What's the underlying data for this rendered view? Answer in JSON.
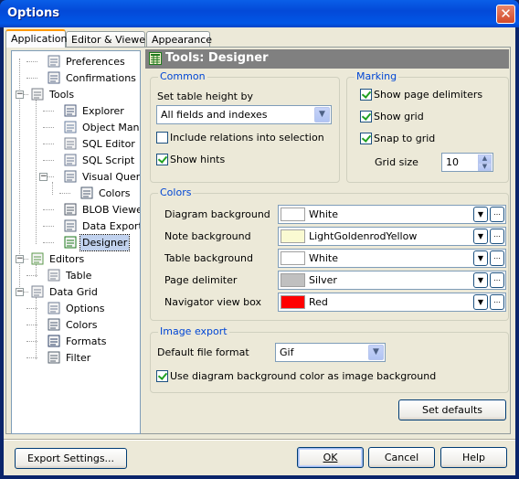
{
  "window": {
    "title": "Options"
  },
  "tabs": [
    {
      "label": "Application",
      "active": true
    },
    {
      "label": "Editor & Viewers",
      "active": false
    },
    {
      "label": "Appearance",
      "active": false
    }
  ],
  "tree": [
    {
      "label": "Preferences",
      "icon": "preferences-icon"
    },
    {
      "label": "Confirmations",
      "icon": "confirmations-icon"
    },
    {
      "label": "Tools",
      "icon": "tools-icon",
      "expanded": true
    },
    {
      "label": "Explorer",
      "icon": "explorer-icon"
    },
    {
      "label": "Object Manager",
      "icon": "object-manager-icon"
    },
    {
      "label": "SQL Editor",
      "icon": "sql-editor-icon"
    },
    {
      "label": "SQL Script",
      "icon": "sql-script-icon"
    },
    {
      "label": "Visual Query Builder",
      "icon": "visual-query-builder-icon",
      "expanded": true
    },
    {
      "label": "Colors",
      "icon": "colors-icon"
    },
    {
      "label": "BLOB Viewer",
      "icon": "blob-viewer-icon"
    },
    {
      "label": "Data Export",
      "icon": "data-export-icon"
    },
    {
      "label": "Designer",
      "icon": "designer-icon",
      "selected": true
    },
    {
      "label": "Editors",
      "icon": "editors-icon",
      "expanded": true
    },
    {
      "label": "Table",
      "icon": "table-icon"
    },
    {
      "label": "Data Grid",
      "icon": "data-grid-icon",
      "expanded": true
    },
    {
      "label": "Options",
      "icon": "options-icon"
    },
    {
      "label": "Colors",
      "icon": "colors-icon"
    },
    {
      "label": "Formats",
      "icon": "formats-icon"
    },
    {
      "label": "Filter",
      "icon": "filter-icon"
    }
  ],
  "header": {
    "title": "Tools: Designer"
  },
  "common": {
    "legend": "Common",
    "table_height_label": "Set table height by",
    "table_height_value": "All fields and indexes",
    "include_relations": {
      "label": "Include relations into selection",
      "checked": false
    },
    "show_hints": {
      "label": "Show hints",
      "checked": true
    }
  },
  "marking": {
    "legend": "Marking",
    "show_page_delimiters": {
      "label": "Show page delimiters",
      "checked": true
    },
    "show_grid": {
      "label": "Show grid",
      "checked": true
    },
    "snap_to_grid": {
      "label": "Snap to grid",
      "checked": true
    },
    "grid_size_label": "Grid size",
    "grid_size_value": "10"
  },
  "colors": {
    "legend": "Colors",
    "items": [
      {
        "label": "Diagram background",
        "name": "White",
        "hex": "#FFFFFF"
      },
      {
        "label": "Note background",
        "name": "LightGoldenrodYellow",
        "hex": "#FAFAD2"
      },
      {
        "label": "Table background",
        "name": "White",
        "hex": "#FFFFFF"
      },
      {
        "label": "Page delimiter",
        "name": "Silver",
        "hex": "#C0C0C0"
      },
      {
        "label": "Navigator view box",
        "name": "Red",
        "hex": "#FF0000"
      }
    ]
  },
  "image_export": {
    "legend": "Image export",
    "format_label": "Default file format",
    "format_value": "Gif",
    "use_bg": {
      "label": "Use diagram background color as image background",
      "checked": true
    }
  },
  "buttons": {
    "set_defaults": "Set defaults",
    "export_settings": "Export Settings...",
    "ok": "OK",
    "cancel": "Cancel",
    "help": "Help"
  }
}
